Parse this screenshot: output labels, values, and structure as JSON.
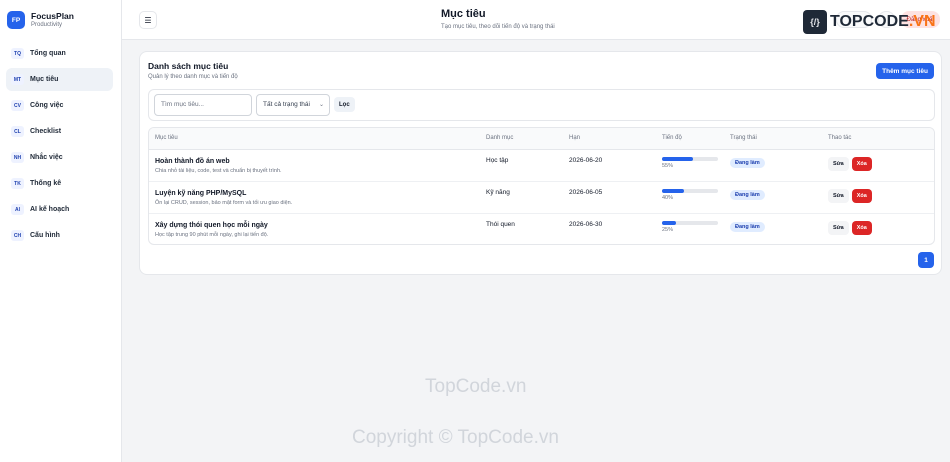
{
  "brand": {
    "logo": "FP",
    "name": "FocusPlan",
    "subtitle": "Productivity"
  },
  "sidebar": {
    "items": [
      {
        "badge": "TQ",
        "label": "Tổng quan",
        "active": false
      },
      {
        "badge": "MT",
        "label": "Mục tiêu",
        "active": true
      },
      {
        "badge": "CV",
        "label": "Công việc",
        "active": false
      },
      {
        "badge": "CL",
        "label": "Checklist",
        "active": false
      },
      {
        "badge": "NH",
        "label": "Nhắc việc",
        "active": false
      },
      {
        "badge": "TK",
        "label": "Thống kê",
        "active": false
      },
      {
        "badge": "AI",
        "label": "AI kế hoạch",
        "active": false
      },
      {
        "badge": "CH",
        "label": "Cấu hình",
        "active": false
      }
    ]
  },
  "topbar": {
    "menu_icon": "☰",
    "title": "Mục tiêu",
    "subtitle": "Tạo mục tiêu, theo dõi tiến độ và trạng thái",
    "logout_label": "Đăng xuất"
  },
  "card": {
    "title": "Danh sách mục tiêu",
    "subtitle": "Quản lý theo danh mục và tiến độ",
    "add_button": "Thêm mục tiêu"
  },
  "filter": {
    "search_placeholder": "Tìm mục tiêu...",
    "status_selected": "Tất cả trạng thái",
    "filter_button": "Lọc"
  },
  "table": {
    "headers": [
      "Mục tiêu",
      "Danh mục",
      "Hạn",
      "Tiến độ",
      "Trạng thái",
      "Thao tác"
    ],
    "rows": [
      {
        "title": "Hoàn thành đồ án web",
        "desc": "Chia nhỏ tài liệu, code, test và chuẩn bị thuyết trình.",
        "category": "Học tập",
        "due": "2026-06-20",
        "progress": 55,
        "progress_label": "55%",
        "status": "Đang làm",
        "edit": "Sửa",
        "delete": "Xóa"
      },
      {
        "title": "Luyện kỹ năng PHP/MySQL",
        "desc": "Ôn lại CRUD, session, bảo mật form và tối ưu giao diện.",
        "category": "Kỹ năng",
        "due": "2026-06-05",
        "progress": 40,
        "progress_label": "40%",
        "status": "Đang làm",
        "edit": "Sửa",
        "delete": "Xóa"
      },
      {
        "title": "Xây dựng thói quen học mỗi ngày",
        "desc": "Học tập trung 90 phút mỗi ngày, ghi lại tiến độ.",
        "category": "Thói quen",
        "due": "2026-06-30",
        "progress": 25,
        "progress_label": "25%",
        "status": "Đang làm",
        "edit": "Sửa",
        "delete": "Xóa"
      }
    ]
  },
  "pagination": {
    "current": "1"
  },
  "watermark": {
    "logo_text_dark": "TOPCODE",
    "logo_text_accent": ".VN",
    "middle": "TopCode.vn",
    "copyright": "Copyright © TopCode.vn"
  },
  "colors": {
    "accent": "#2563eb",
    "danger": "#dc2626",
    "status_bg": "#e0ecff"
  }
}
